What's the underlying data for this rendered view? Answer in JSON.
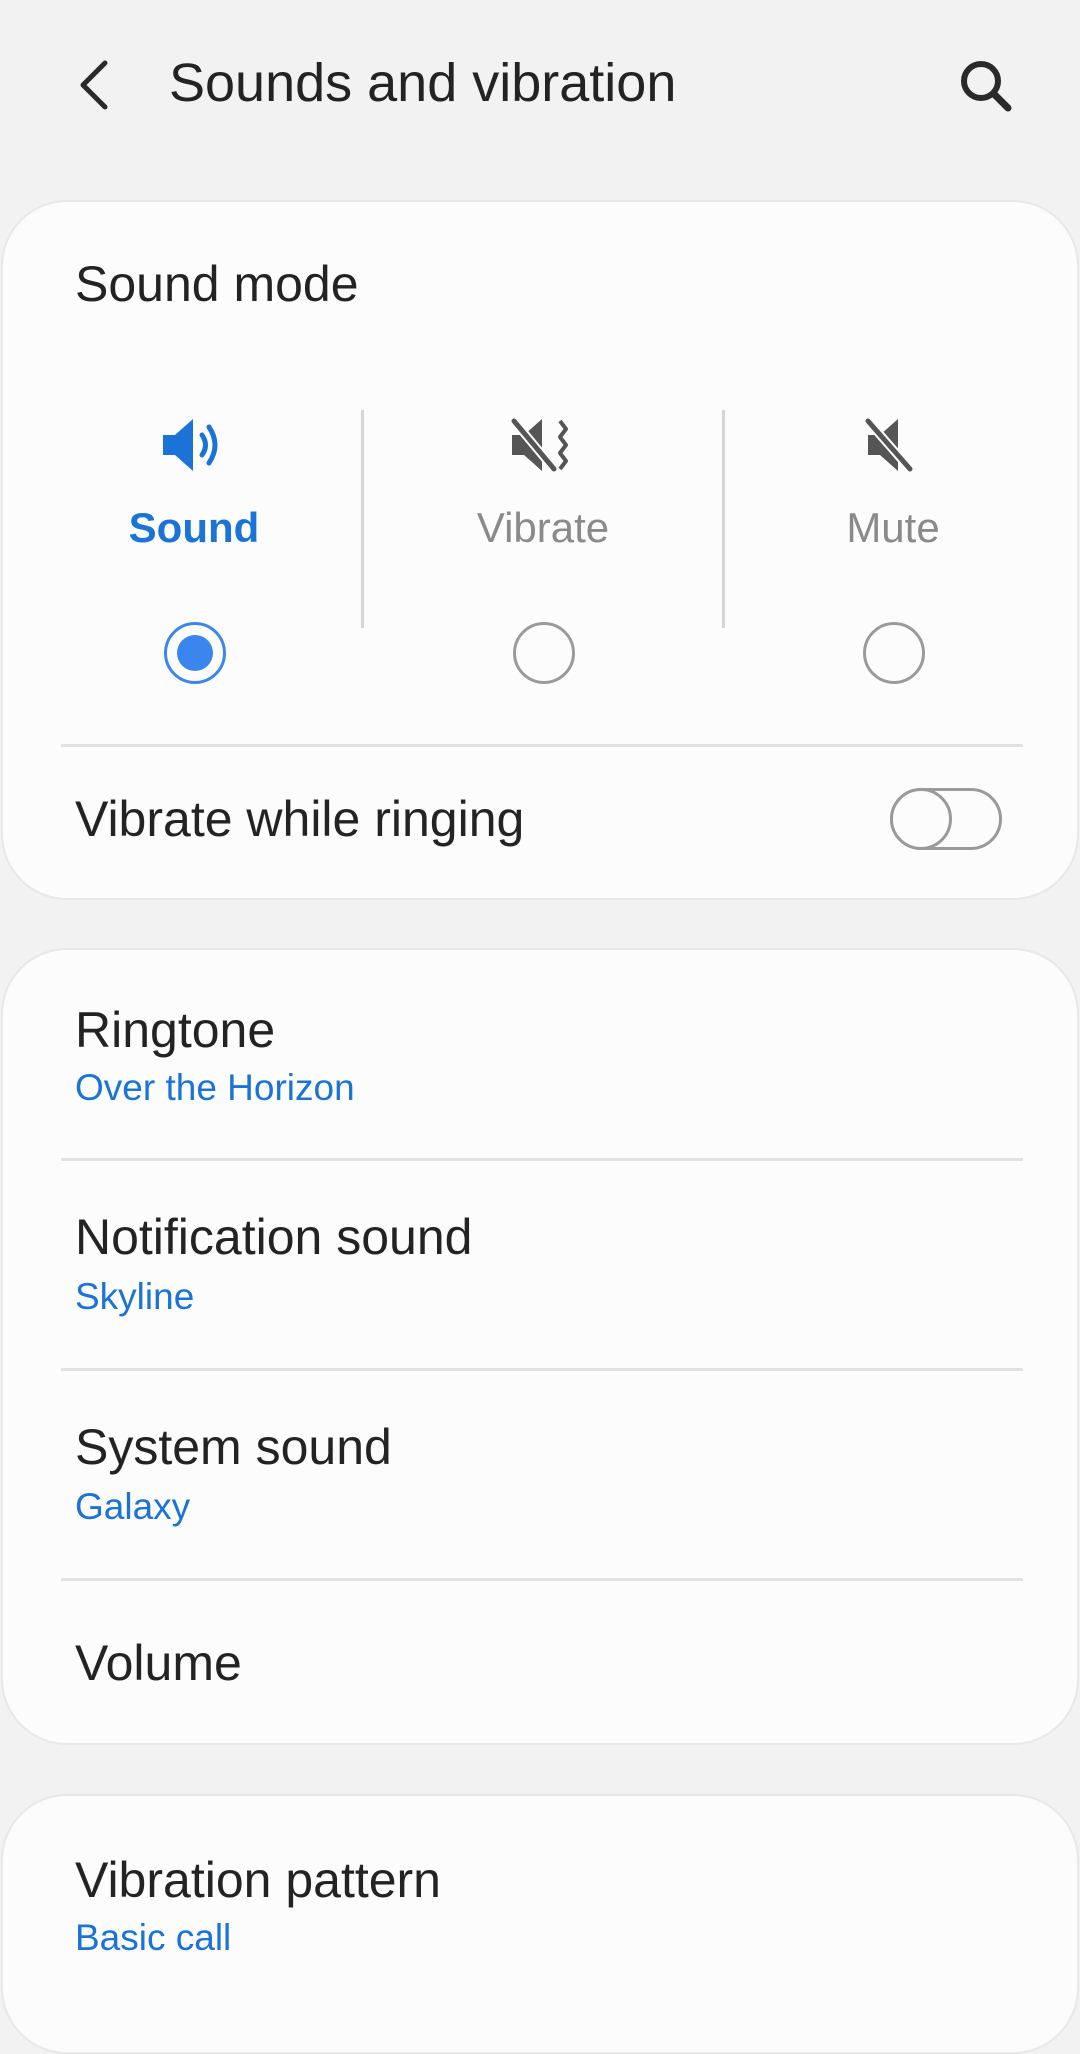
{
  "header": {
    "title": "Sounds and vibration",
    "back_icon": "chevron-left-icon",
    "search_icon": "search-icon"
  },
  "sound_mode": {
    "title": "Sound mode",
    "selected": "Sound",
    "options": [
      {
        "label": "Sound",
        "icon": "speaker-icon",
        "checked": true
      },
      {
        "label": "Vibrate",
        "icon": "vibrate-icon",
        "checked": false
      },
      {
        "label": "Mute",
        "icon": "mute-icon",
        "checked": false
      }
    ],
    "vibrate_while_ringing": {
      "label": "Vibrate while ringing",
      "enabled": false
    }
  },
  "settings": [
    {
      "title": "Ringtone",
      "value": "Over the Horizon"
    },
    {
      "title": "Notification sound",
      "value": "Skyline"
    },
    {
      "title": "System sound",
      "value": "Galaxy"
    },
    {
      "title": "Volume"
    }
  ],
  "vibration": [
    {
      "title": "Vibration pattern",
      "value": "Basic call"
    }
  ],
  "colors": {
    "accent": "#1b73d8",
    "radio_selected": "#3b86ee",
    "background": "#f2f2f2",
    "card": "#fcfcfc",
    "inactive": "#8a8a8a"
  }
}
